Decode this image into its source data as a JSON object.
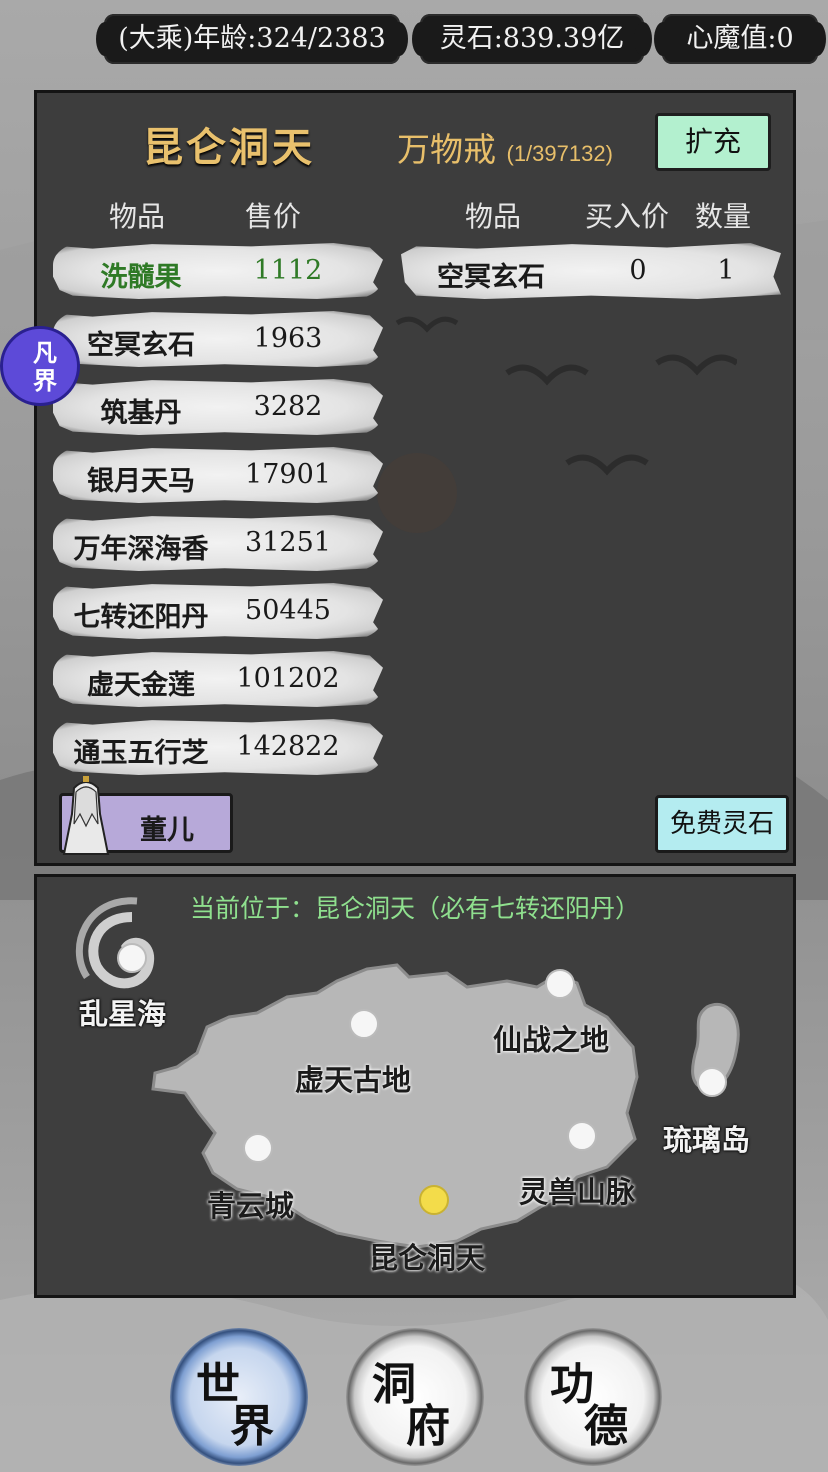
{
  "status_bar": {
    "age_text": "(大乘)年龄:324/2383",
    "spirit_stone_text": "灵石:839.39亿",
    "heart_demon_text": "心魔值:0"
  },
  "shop": {
    "location_title": "昆仑洞天",
    "ring_title": "万物戒",
    "ring_capacity": "(1/397132)",
    "expand_button": "扩充",
    "sell_headers": {
      "item": "物品",
      "price": "售价"
    },
    "buy_headers": {
      "item": "物品",
      "buy_price": "买入价",
      "quantity": "数量"
    },
    "sell_items": [
      {
        "name": "洗髓果",
        "price": "1112",
        "selected": true
      },
      {
        "name": "空冥玄石",
        "price": "1963"
      },
      {
        "name": "筑基丹",
        "price": "3282"
      },
      {
        "name": "银月天马",
        "price": "17901"
      },
      {
        "name": "万年深海香",
        "price": "31251"
      },
      {
        "name": "七转还阳丹",
        "price": "50445"
      },
      {
        "name": "虚天金莲",
        "price": "101202"
      },
      {
        "name": "通玉五行芝",
        "price": "142822"
      }
    ],
    "ring_items": [
      {
        "name": "空冥玄石",
        "buy_price": "0",
        "quantity": "1"
      }
    ],
    "npc_button": "董儿",
    "free_stone_button": "免费灵石",
    "realm_badge": "凡界"
  },
  "map": {
    "current_location_text": "当前位于：昆仑洞天（必有七转还阳丹）",
    "places": [
      {
        "name": "乱星海",
        "current": false
      },
      {
        "name": "虚天古地",
        "current": false
      },
      {
        "name": "仙战之地",
        "current": false
      },
      {
        "name": "琉璃岛",
        "current": false
      },
      {
        "name": "青云城",
        "current": false
      },
      {
        "name": "灵兽山脉",
        "current": false
      },
      {
        "name": "昆仑洞天",
        "current": true
      }
    ]
  },
  "nav": {
    "world": [
      "世",
      "界"
    ],
    "cave": [
      "洞",
      "府"
    ],
    "merit": [
      "功",
      "德"
    ],
    "active": "world"
  },
  "colors": {
    "gold_title": "#e9c16d",
    "selected_item": "#2f7a26",
    "map_location_text": "#8fe08e",
    "expand_button": "#b3f0cf",
    "free_button": "#b4ecf0",
    "npc_button": "#b7a9d9",
    "realm_badge": "#5d4ad8",
    "current_node": "#f3dc4a"
  }
}
